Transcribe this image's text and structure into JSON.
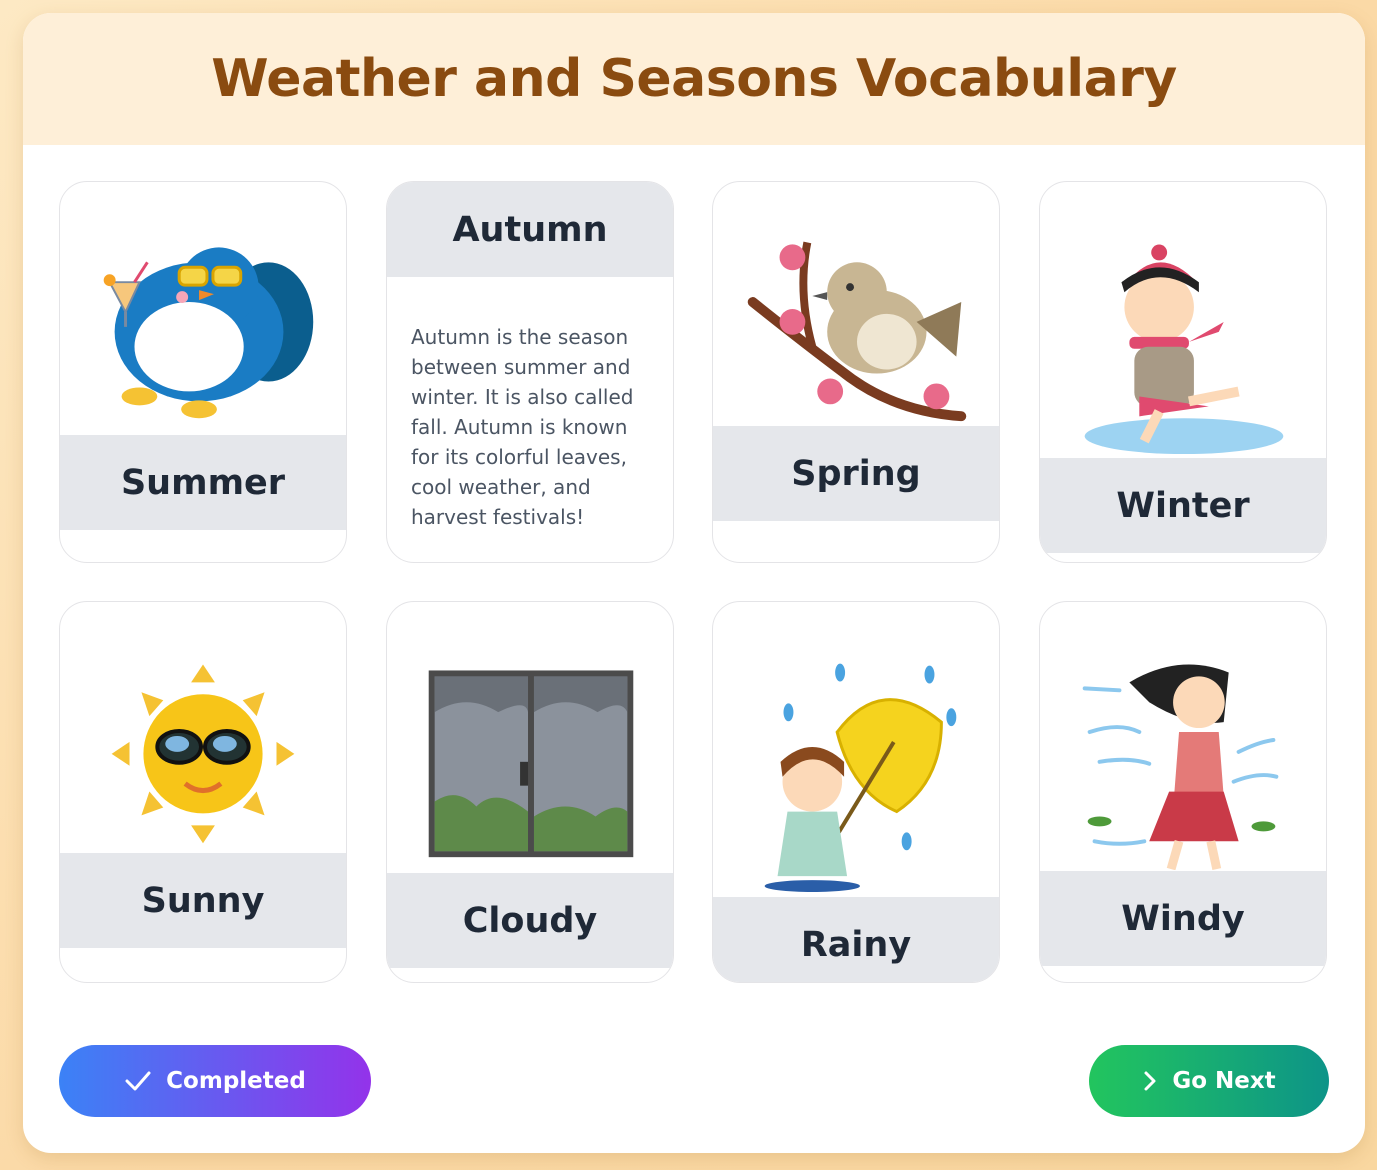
{
  "page": {
    "title": "Weather and Seasons Vocabulary"
  },
  "cards": [
    {
      "label": "Summer",
      "flipped": false,
      "icon": "penguin-sunglasses-icon"
    },
    {
      "label": "Autumn",
      "flipped": true,
      "description": "Autumn is the season between summer and winter. It is also called fall. Autumn is known for its colorful leaves, cool weather, and harvest festivals!"
    },
    {
      "label": "Spring",
      "flipped": false,
      "icon": "bird-blossom-branch-icon"
    },
    {
      "label": "Winter",
      "flipped": false,
      "icon": "girl-ice-skating-icon"
    },
    {
      "label": "Sunny",
      "flipped": false,
      "icon": "sun-sunglasses-icon"
    },
    {
      "label": "Cloudy",
      "flipped": false,
      "icon": "cloudy-window-icon"
    },
    {
      "label": "Rainy",
      "flipped": false,
      "icon": "girl-umbrella-rain-icon"
    },
    {
      "label": "Windy",
      "flipped": false,
      "icon": "woman-in-wind-icon"
    }
  ],
  "buttons": {
    "completed": {
      "label": "Completed",
      "icon": "checkmark-icon"
    },
    "next": {
      "label": "Go Next",
      "icon": "chevron-right-icon"
    }
  }
}
